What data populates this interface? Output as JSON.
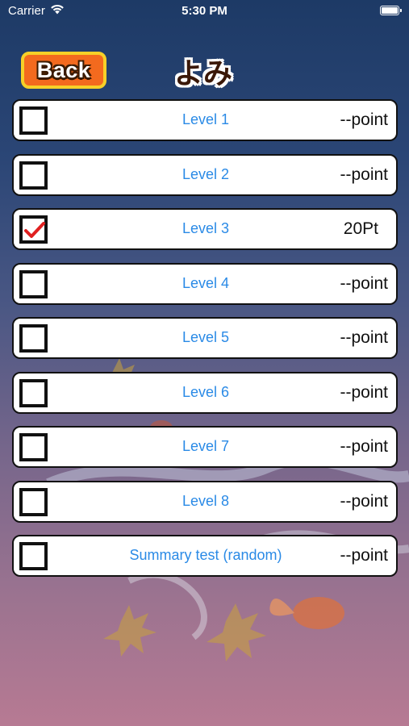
{
  "status_bar": {
    "carrier": "Carrier",
    "time": "5:30 PM"
  },
  "header": {
    "back_label": "Back",
    "title": "よみ"
  },
  "levels": [
    {
      "label": "Level 1",
      "score": "--point",
      "checked": false
    },
    {
      "label": "Level 2",
      "score": "--point",
      "checked": false
    },
    {
      "label": "Level 3",
      "score": "20Pt",
      "checked": true
    },
    {
      "label": "Level 4",
      "score": "--point",
      "checked": false
    },
    {
      "label": "Level 5",
      "score": "--point",
      "checked": false
    },
    {
      "label": "Level 6",
      "score": "--point",
      "checked": false
    },
    {
      "label": "Level 7",
      "score": "--point",
      "checked": false
    },
    {
      "label": "Level 8",
      "score": "--point",
      "checked": false
    },
    {
      "label": "Summary test (random)",
      "score": "--point",
      "checked": false
    }
  ],
  "colors": {
    "accent": "#2a8ae6",
    "check": "#e02020",
    "back_button": "#f36a1e",
    "back_border": "#f7d028"
  }
}
